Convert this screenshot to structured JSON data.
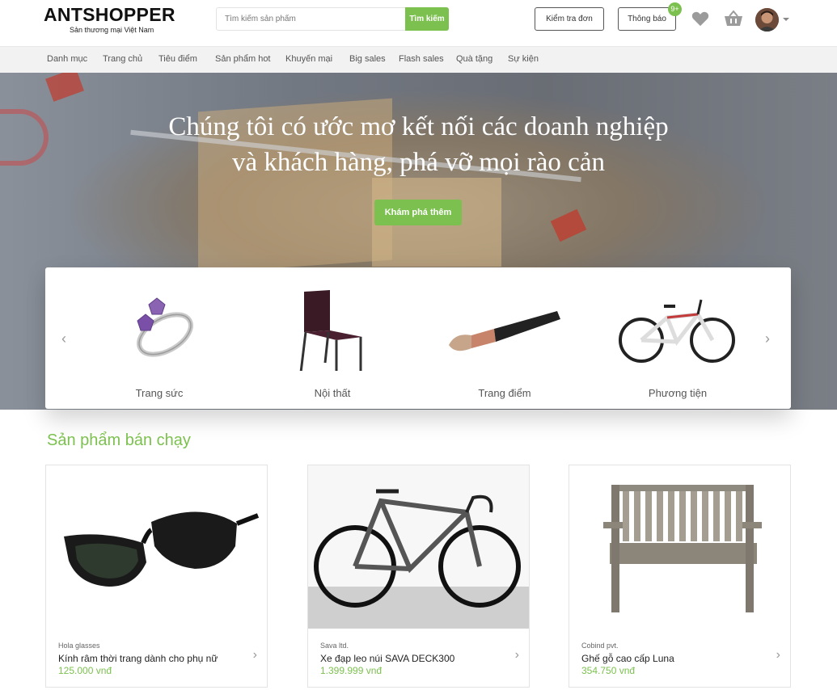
{
  "brand": {
    "logo": "ANTSHOPPER",
    "tagline": "Sản thương mại Việt Nam"
  },
  "search": {
    "placeholder": "Tìm kiếm sản phẩm",
    "button": "Tìm kiếm"
  },
  "header_buttons": {
    "check_order": "Kiểm tra đơn",
    "notifications": "Thông báo",
    "notification_count": "9+"
  },
  "icons": {
    "wishlist": "heart-icon",
    "cart": "basket-icon",
    "account_menu": "chevron-down-icon"
  },
  "nav": {
    "items": [
      {
        "label": "Danh mục"
      },
      {
        "label": "Trang chủ"
      },
      {
        "label": "Tiêu điểm"
      },
      {
        "label": "Sản phẩm hot"
      },
      {
        "label": "Khuyến mại"
      },
      {
        "label": "Big sales"
      },
      {
        "label": "Flash sales"
      },
      {
        "label": "Quà tặng"
      },
      {
        "label": "Sự kiện"
      }
    ]
  },
  "hero": {
    "line1": "Chúng tôi có ước mơ kết nối các doanh nghiệp",
    "line2": "và khách hàng, phá vỡ mọi rào cản",
    "button": "Khám phá thêm"
  },
  "categories": {
    "prev": "‹",
    "next": "›",
    "items": [
      {
        "label": "Trang sức",
        "icon": "ring-image"
      },
      {
        "label": "Nội thất",
        "icon": "chair-image"
      },
      {
        "label": "Trang điểm",
        "icon": "makeup-brush-image"
      },
      {
        "label": "Phương tiện",
        "icon": "bicycle-image"
      }
    ]
  },
  "best_sellers": {
    "title": "Sản phẩm bán chạy",
    "products": [
      {
        "brand": "Hola glasses",
        "name": "Kính râm thời trang dành cho phụ nữ",
        "price": "125.000 vnđ",
        "arrow": "›"
      },
      {
        "brand": "Sava ltd.",
        "name": "Xe đạp leo núi SAVA DECK300",
        "price": "1.399.999 vnđ",
        "arrow": "›"
      },
      {
        "brand": "Cobind pvt.",
        "name": "Ghế gỗ cao cấp Luna",
        "price": "354.750 vnđ",
        "arrow": "›"
      }
    ]
  },
  "colors": {
    "accent": "#7cc14f",
    "nav_bg": "#f2f2f2",
    "text": "#333333"
  }
}
